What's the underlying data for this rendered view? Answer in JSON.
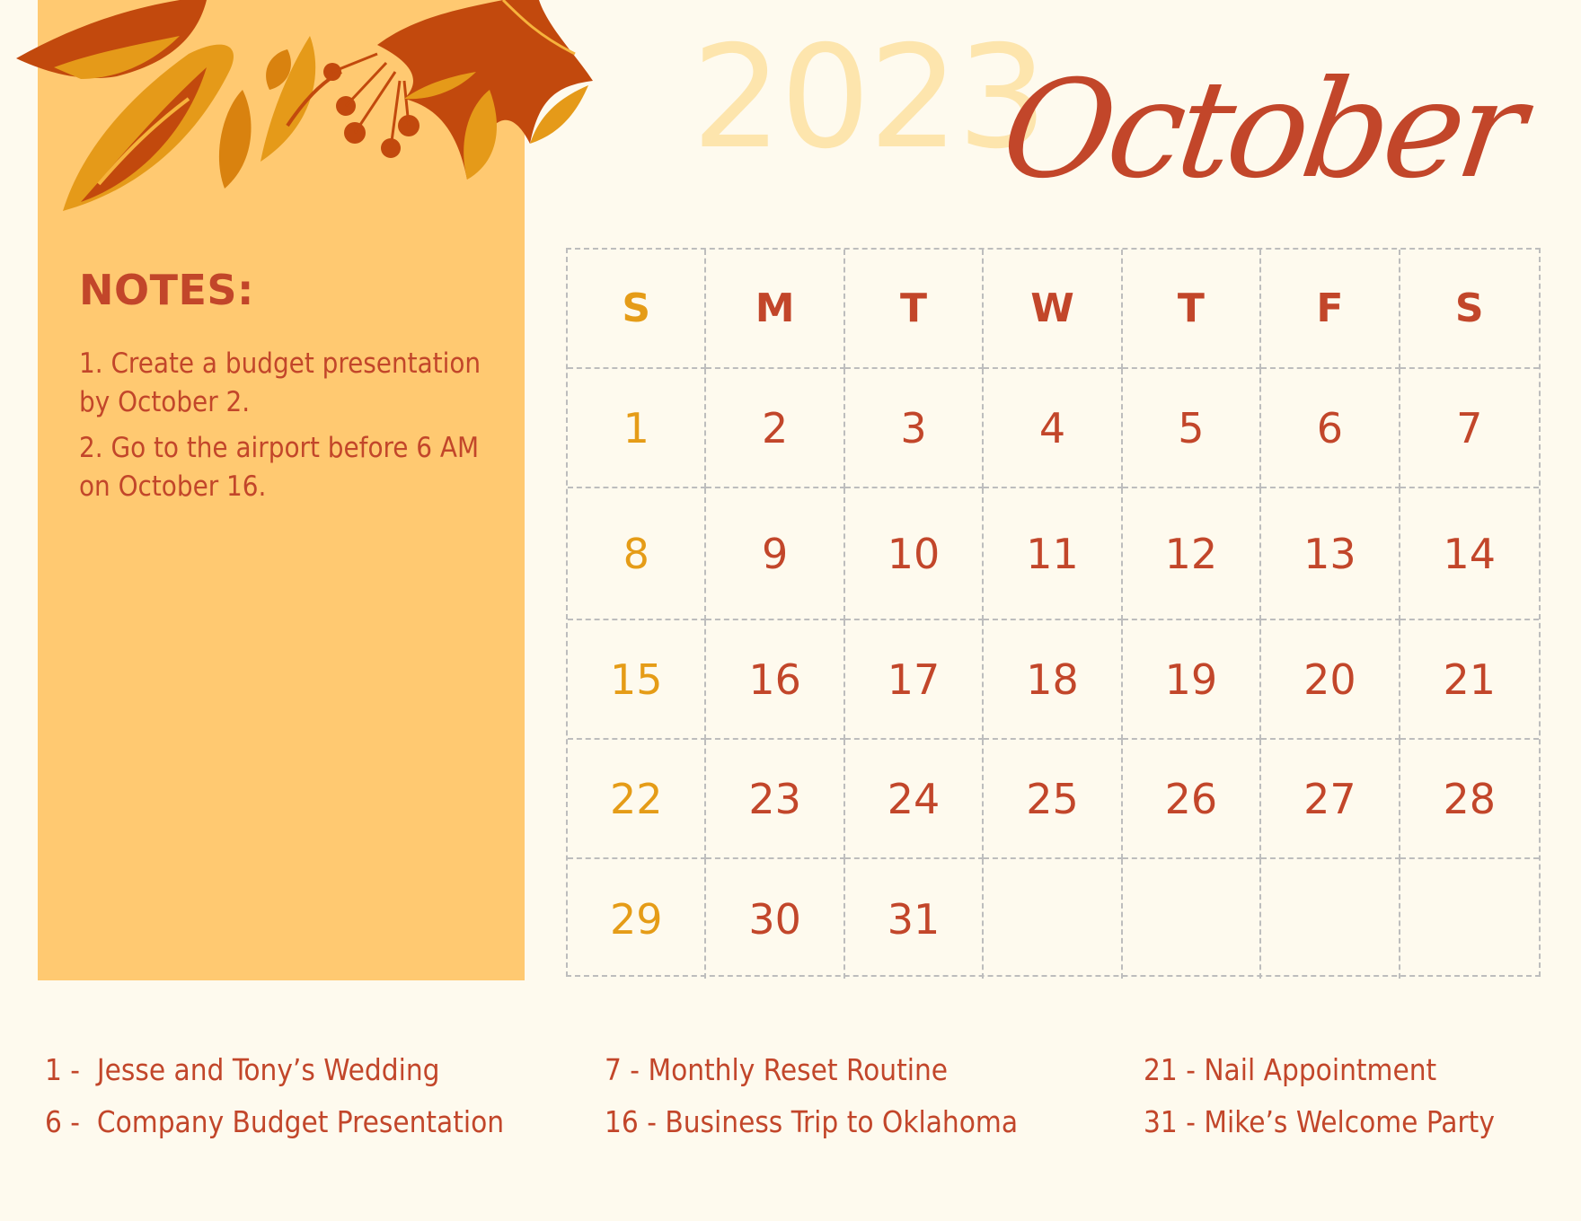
{
  "header": {
    "year": "2023",
    "month": "October"
  },
  "notes": {
    "title": "NOTES:",
    "items": [
      "1. Create a budget presentation by October 2.",
      "2. Go to the airport before 6 AM on October 16."
    ]
  },
  "calendar": {
    "weekdays": [
      "S",
      "M",
      "T",
      "W",
      "T",
      "F",
      "S"
    ],
    "weeks": [
      [
        "1",
        "2",
        "3",
        "4",
        "5",
        "6",
        "7"
      ],
      [
        "8",
        "9",
        "10",
        "11",
        "12",
        "13",
        "14"
      ],
      [
        "15",
        "16",
        "17",
        "18",
        "19",
        "20",
        "21"
      ],
      [
        "22",
        "23",
        "24",
        "25",
        "26",
        "27",
        "28"
      ],
      [
        "29",
        "30",
        "31",
        "",
        "",
        "",
        ""
      ]
    ]
  },
  "events": [
    "1 -  Jesse and Tony’s Wedding",
    "6 -  Company Budget Presentation",
    "7 - Monthly Reset Routine",
    "16 - Business Trip to Oklahoma",
    "21 - Nail Appointment",
    "31 - Mike’s Welcome Party"
  ],
  "colors": {
    "background": "#fefaee",
    "panel": "#ffc971",
    "primary_text": "#c2462a",
    "sunday_accent": "#e59c17",
    "year_watermark": "#fde5ad",
    "grid_line": "#bdbdbd"
  },
  "decoration": {
    "icon": "autumn-leaves-icon"
  }
}
